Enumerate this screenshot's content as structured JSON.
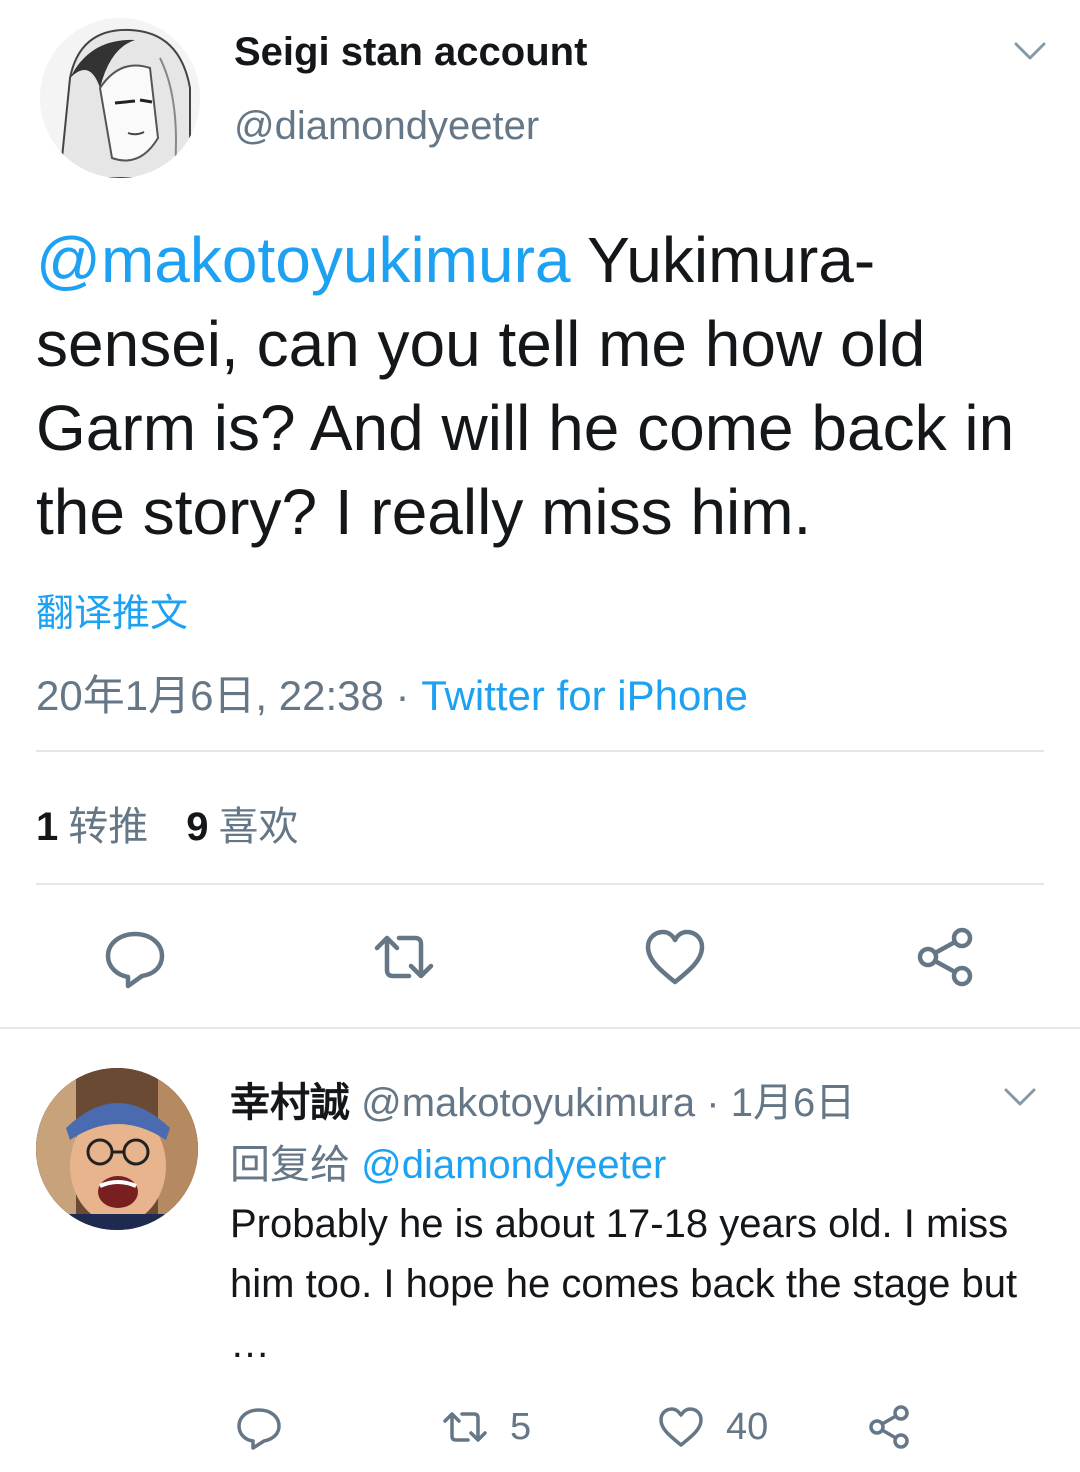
{
  "tweet": {
    "display_name": "Seigi stan account",
    "handle": "@diamondyeeter",
    "mention": "@makotoyukimura",
    "text": "Yukimura-sensei, can you tell me how old Garm is? And will he come back in the story? I really miss him.",
    "translate_label": "翻译推文",
    "timestamp": "20年1月6日, 22:38",
    "separator": "·",
    "source": "Twitter for iPhone",
    "retweets_count": "1",
    "retweets_label": "转推",
    "likes_count": "9",
    "likes_label": "喜欢",
    "icons": {
      "more": "chevron-down-icon",
      "reply": "reply-icon",
      "retweet": "retweet-icon",
      "like": "heart-icon",
      "share": "share-icon"
    }
  },
  "reply": {
    "display_name": "幸村誠",
    "handle": "@makotoyukimura",
    "separator": "·",
    "date": "1月6日",
    "replying_label": "回复给",
    "replying_to": "@diamondyeeter",
    "text": "Probably he is about 17-18 years old. I miss him too. I hope he comes back the stage but …",
    "retweet_count": "5",
    "like_count": "40"
  },
  "colors": {
    "accent": "#1da1f2",
    "secondary_text": "#657786",
    "divider": "#e1e8ed"
  }
}
